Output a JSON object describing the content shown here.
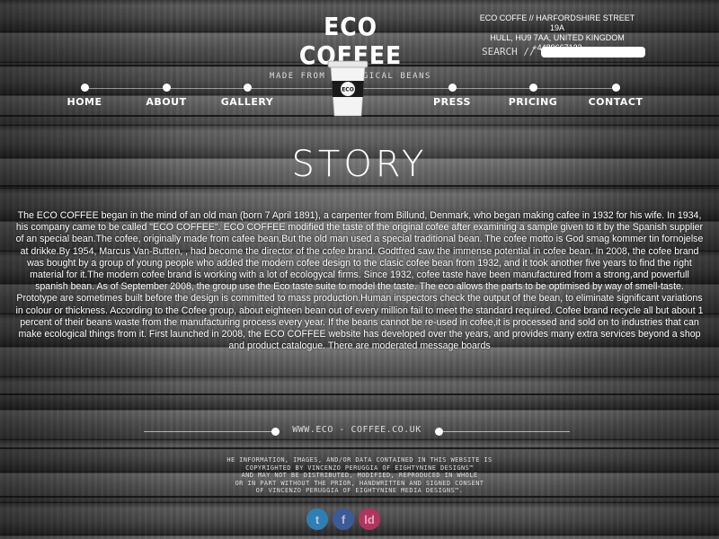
{
  "brand": {
    "title": "ECO COFFEE",
    "subtitle": "MADE FROM ECOLOGICAL BEANS"
  },
  "contact": {
    "line1": "ECO COFFE // HARFORDSHIRE STREET 19A",
    "line2": "HULL, HU9 7AA, UNITED KINGDOM",
    "line3": "+4489667122"
  },
  "search": {
    "label": "SEARCH //",
    "value": ""
  },
  "cup": {
    "label": "ECO"
  },
  "nav": {
    "items": [
      {
        "label": "HOME"
      },
      {
        "label": "ABOUT"
      },
      {
        "label": "GALLERY"
      },
      {
        "label": "PRESS"
      },
      {
        "label": "PRICING"
      },
      {
        "label": "CONTACT"
      }
    ]
  },
  "story": {
    "title": "STORY",
    "body": "The ECO COFFEE began in the mind of an old man (born 7 April 1891), a carpenter from Billund, Denmark, who began making cafee in 1932 for his wife. In 1934, his company came to be called \"ECO COFFEE\". ECO COFFEE modified the taste of the original cofee after examining a sample given to it by the Spanish supplier of an special bean.The cofee, originally made from cafee bean,But the old man used a special traditional bean. The cofee motto is God smag kommer tin fornojelse at drikke.By 1954, Marcus Van-Butten, , had become the director of the cofee brand. Godtfred saw the immense potential in cofee bean. In 2008, the cofee brand was bought by a group of young people who added the modern cofee design to the clasic cofee bean from 1932, and it took another five years to find the right material for it.The modern cofee brand is working with a lot of ecologycal firms. Since 1932, cofee taste have been manufactured from a strong,and powerfull spanish bean. As of September 2008, the group use the Eco taste suite to model the taste. The eco allows the parts to be optimised by way of smell-taste. Prototype are sometimes built before the design is committed to mass production.Human inspectors check the output of the bean, to eliminate significant variations in colour or thickness. According to the Cofee group, about eighteen bean out of every million fail to meet the standard required. Cofee brand recycle all but about 1 percent of their beans waste from the manufacturing process every year. If the beans cannot be re-used in cofee,it is processed and sold on to industries that can make ecological things from it. First launched in 2008, the ECO COFFEE website has developed over the years, and provides many extra services beyond a shop and product catalogue. There are moderated message boards"
  },
  "footer": {
    "url": "WWW.ECO - COFFEE.CO.UK",
    "copyright_lines": [
      "HE INFORMATION, IMAGES, AND/OR DATA CONTAINED IN THIS WEBSITE IS",
      "COPYRIGHTED BY VINCENZO PERUGGIA OF EIGHTYNINE DESIGNS™",
      "AND MAY NOT BE DISTRIBUTED, MODIFIED, REPRODUCED IN WHOLE",
      "OR IN PART WITHOUT THE PRIOR, HANDWRITTEN AND SIGNED CONSENT",
      "OF VINCENZO PERUGGIA OF EIGHTYNINE MEDIA DESIGNS™."
    ]
  },
  "social": [
    {
      "icon": "twitter-icon",
      "glyph": "t",
      "color": "#2f7fb5"
    },
    {
      "icon": "facebook-icon",
      "glyph": "f",
      "color": "#3b5a96"
    },
    {
      "icon": "linkedin-icon",
      "glyph": "ld",
      "color": "#b2345e"
    }
  ]
}
